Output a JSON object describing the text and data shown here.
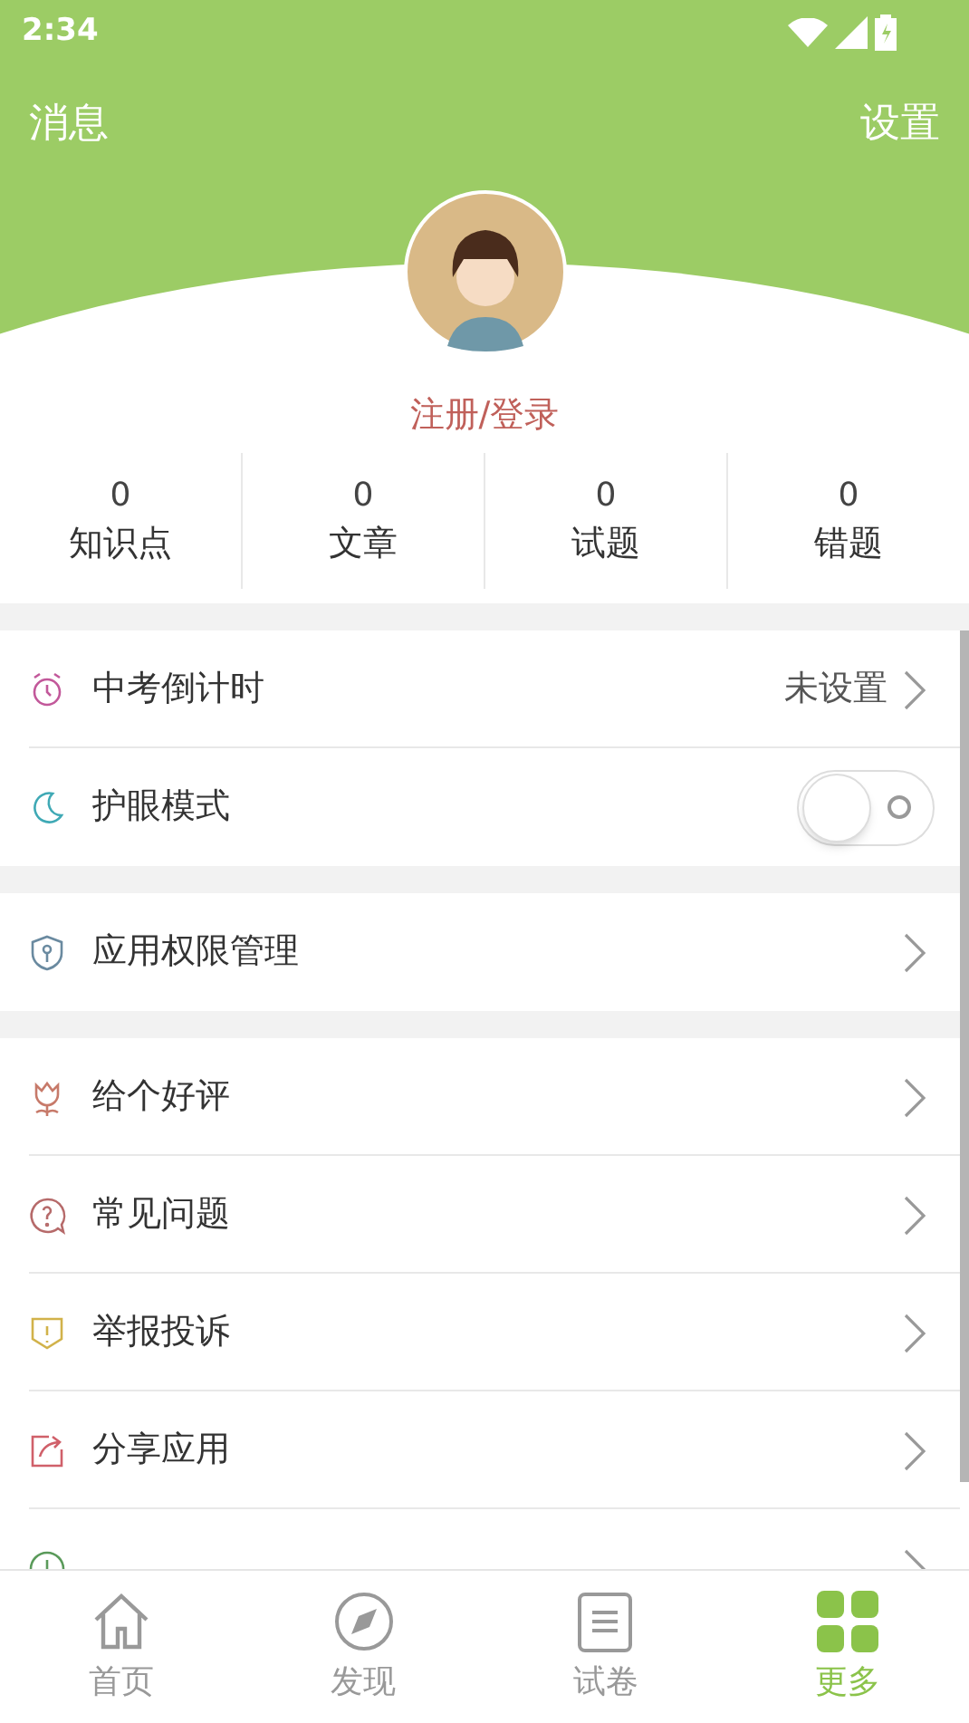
{
  "status_bar": {
    "time": "2:34"
  },
  "header": {
    "left": "消息",
    "right": "设置"
  },
  "profile": {
    "login": "注册/登录"
  },
  "stats": [
    {
      "value": "0",
      "label": "知识点"
    },
    {
      "value": "0",
      "label": "文章"
    },
    {
      "value": "0",
      "label": "试题"
    },
    {
      "value": "0",
      "label": "错题"
    }
  ],
  "menu_groups": [
    [
      {
        "kind": "link",
        "label": "中考倒计时",
        "value": "未设置"
      },
      {
        "kind": "toggle",
        "label": "护眼模式",
        "on": false
      }
    ],
    [
      {
        "kind": "link",
        "label": "应用权限管理"
      }
    ],
    [
      {
        "kind": "link",
        "label": "给个好评"
      },
      {
        "kind": "link",
        "label": "常见问题"
      },
      {
        "kind": "link",
        "label": "举报投诉"
      },
      {
        "kind": "link",
        "label": "分享应用"
      },
      {
        "kind": "link"
      }
    ]
  ],
  "nav": [
    {
      "label": "首页",
      "selected": false
    },
    {
      "label": "发现",
      "selected": false
    },
    {
      "label": "试卷",
      "selected": false
    },
    {
      "label": "更多",
      "selected": true
    }
  ]
}
